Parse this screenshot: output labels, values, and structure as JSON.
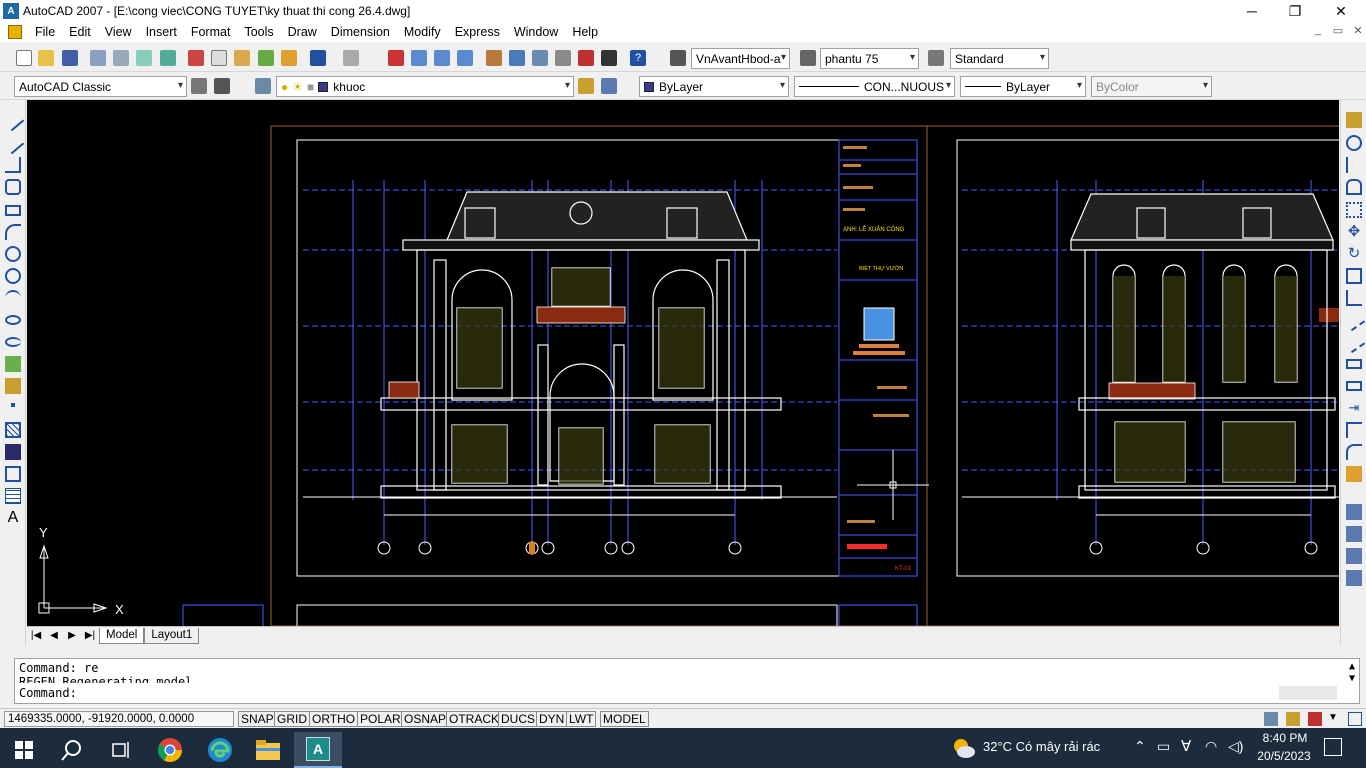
{
  "window": {
    "title": "AutoCAD 2007 - [E:\\cong viec\\CONG TUYET\\ky thuat thi cong 26.4.dwg]",
    "app_icon_label": "A",
    "minimize": "─",
    "maximize": "❐",
    "close": "✕"
  },
  "menu": {
    "items": [
      "File",
      "Edit",
      "View",
      "Insert",
      "Format",
      "Tools",
      "Draw",
      "Dimension",
      "Modify",
      "Express",
      "Window",
      "Help"
    ],
    "mdi_minimize": "_",
    "mdi_restore": "▭",
    "mdi_close": "✕"
  },
  "toolbar1": {
    "text_style": "VnAvantHbod-a",
    "dim_style": "phantu 75",
    "table_style": "Standard"
  },
  "toolbar2": {
    "workspace": "AutoCAD Classic",
    "layer": "khuoc",
    "color": "ByLayer",
    "linetype": "CON...NUOUS",
    "lineweight": "ByLayer",
    "plotstyle": "ByColor"
  },
  "drawing": {
    "ucs_x": "X",
    "ucs_y": "Y",
    "title_block_name": "ANH: LÊ XUÂN CÔNG",
    "title_block_project": "BIỆT THỰ VƯỜN",
    "title_block_sheet": "KT-01"
  },
  "tabs": {
    "nav": [
      "|◀",
      "◀",
      "▶",
      "▶|"
    ],
    "items": [
      "Model",
      "Layout1"
    ],
    "active": "Model"
  },
  "command": {
    "line1": "Command: re",
    "line2": "REGEN Regenerating model.",
    "line3": "Command:"
  },
  "status": {
    "coordinates": "1469335.0000, -91920.0000, 0.0000",
    "buttons": [
      "SNAP",
      "GRID",
      "ORTHO",
      "POLAR",
      "OSNAP",
      "OTRACK",
      "DUCS",
      "DYN",
      "LWT",
      "MODEL"
    ]
  },
  "taskbar": {
    "weather": "32°C  Có mây rải rác",
    "time": "8:40 PM",
    "date": "20/5/2023",
    "app_label": "A"
  },
  "colors": {
    "drawing_bg": "#000000",
    "lines_white": "#ffffff",
    "lines_blue": "#4a5cff",
    "accent_red": "#ff2a2a",
    "accent_yellow": "#ffe000",
    "taskbar_bg": "#1c2c3c"
  }
}
